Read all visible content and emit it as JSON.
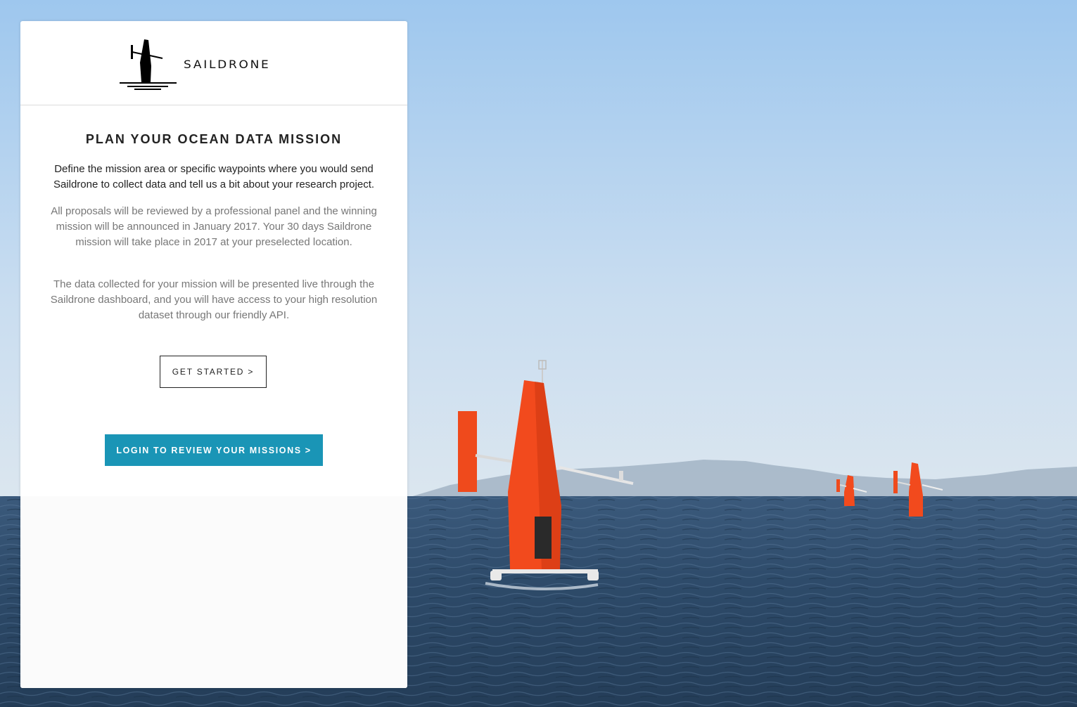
{
  "brand": {
    "wordmark": "SAILDRONE"
  },
  "hero": {
    "title": "PLAN YOUR OCEAN DATA MISSION",
    "intro": "Define the mission area or specific waypoints where you would send Saildrone to collect data and tell us a bit about your research project.",
    "paragraph_1": "All proposals will be reviewed by a professional panel and the winning mission will be announced in January 2017. Your 30 days Saildrone mission will take place in 2017 at your preselected location.",
    "paragraph_2": "The data collected for your mission will be presented live through the Saildrone dashboard, and you will have access to your high resolution dataset through our friendly API."
  },
  "actions": {
    "get_started_label": "GET STARTED >",
    "login_label": "LOGIN TO REVIEW YOUR MISSIONS >"
  },
  "background": {
    "icon": "saildrone-photo",
    "drone_color": "#f24a1d",
    "sea_color": "#2b4663",
    "sky_color": "#b7d3ec"
  },
  "colors": {
    "accent": "#1a95b6",
    "text": "#222222",
    "muted_text": "#777777"
  }
}
